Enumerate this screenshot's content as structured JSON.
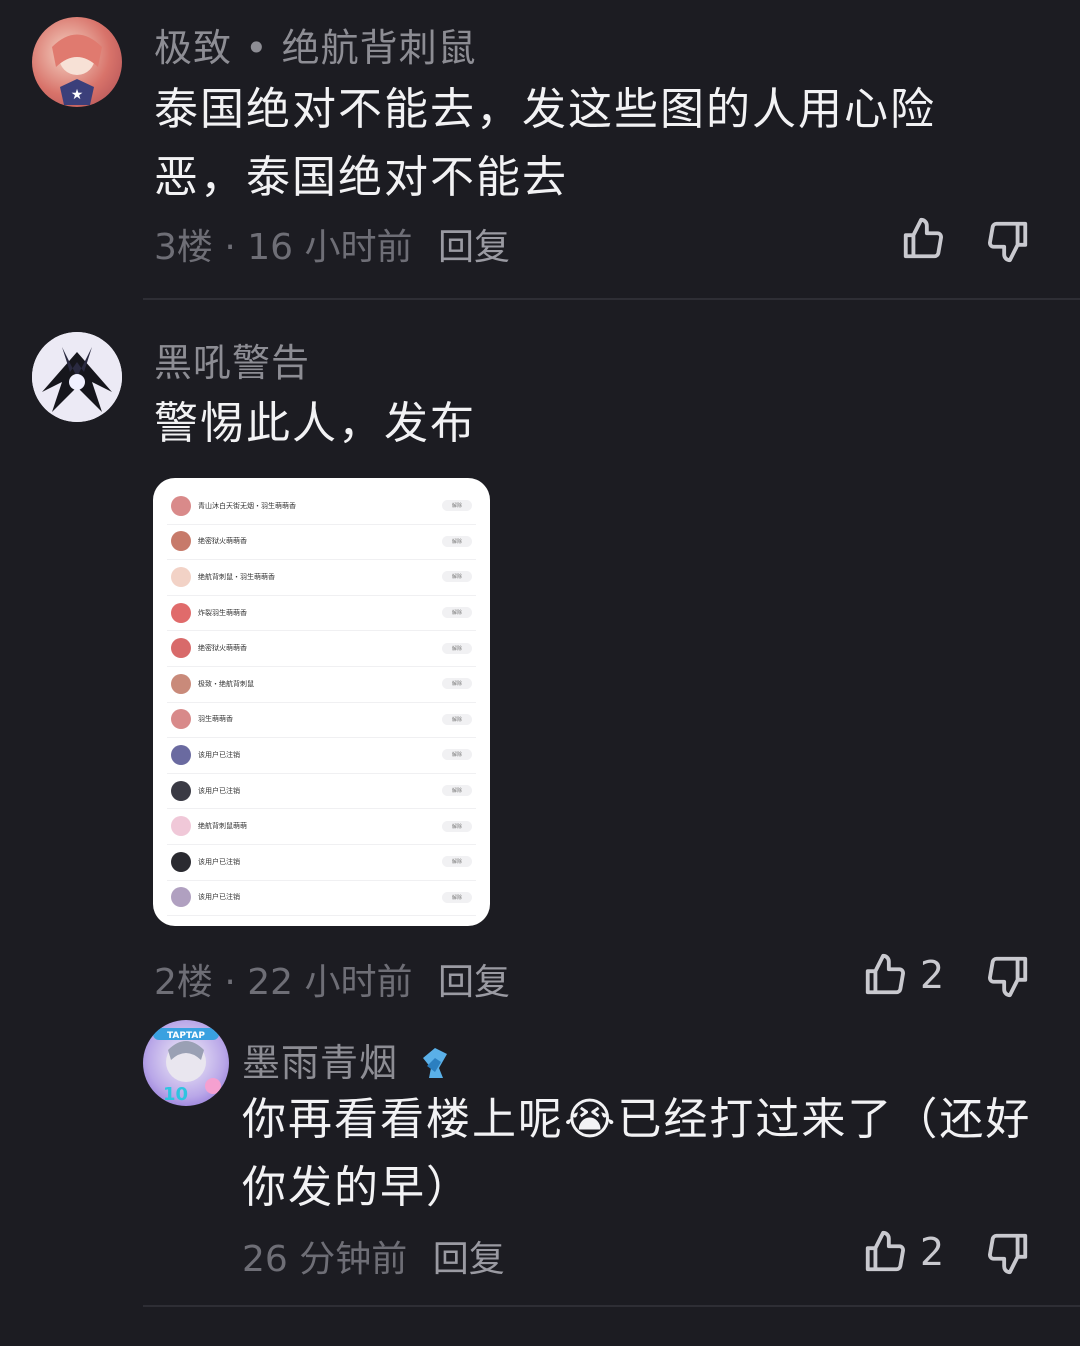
{
  "comments": [
    {
      "username": "极致 • 绝航背刺鼠",
      "text": "泰国绝对不能去，发这些图的人用心险恶，泰国绝对不能去",
      "floor": "3楼",
      "time": "16 小时前",
      "reply": "回复",
      "likes": ""
    },
    {
      "username": "黑吼警告",
      "text": "警惕此人，发布",
      "floor": "2楼",
      "time": "22 小时前",
      "reply": "回复",
      "likes": "2"
    }
  ],
  "sub_reply": {
    "username": "墨雨青烟",
    "text": "你再看看楼上呢😭已经打过来了（还好你发的早）",
    "time": "26 分钟前",
    "reply": "回复",
    "likes": "2"
  },
  "screenshot_list": {
    "button_label": "解除",
    "rows": [
      "青山沐白天街无烟・羽生萌萌香",
      "绝密狱火萌萌香",
      "绝航背刺鼠・羽生萌萌香",
      "炸裂羽生萌萌香",
      "绝密狱火萌萌香",
      "极致・绝航背刺鼠",
      "羽生萌萌香",
      "该用户已注销",
      "该用户已注销",
      "绝航背刺鼠萌萌",
      "该用户已注销",
      "该用户已注销"
    ]
  },
  "colors": {
    "background": "#1c1c22",
    "username": "#8d8d94",
    "meta": "#6e6e76",
    "text": "#f2f2f4"
  }
}
